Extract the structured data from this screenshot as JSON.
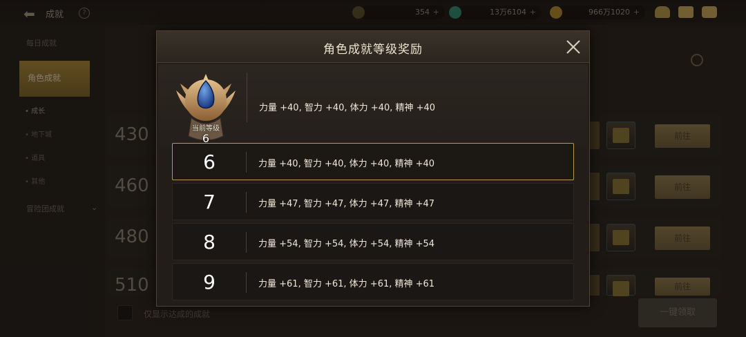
{
  "topbar": {
    "title": "成就",
    "help_icon": "question-icon",
    "currencies": [
      {
        "name": "coin-c-icon",
        "value": "354",
        "color": "#7d6b3a"
      },
      {
        "name": "gem-icon",
        "value": "13万6104",
        "color": "#2f8c74"
      },
      {
        "name": "gold-icon",
        "value": "966万1020",
        "color": "#b48a2e"
      }
    ],
    "icons": [
      "treasure-icon",
      "mail-icon",
      "chat-icon"
    ]
  },
  "sidebar": {
    "items": [
      {
        "label": "每日成就"
      },
      {
        "label": "角色成就",
        "active": true
      },
      {
        "label": "冒险团成就"
      }
    ],
    "sub_items": [
      {
        "label": "• 成长",
        "selected": true
      },
      {
        "label": "• 地下城"
      },
      {
        "label": "• 道具"
      },
      {
        "label": "• 其他"
      }
    ]
  },
  "background_rows": [
    {
      "score": "430",
      "button": "前往"
    },
    {
      "score": "460",
      "button": "前往"
    },
    {
      "score": "480",
      "button": "前往"
    },
    {
      "score": "510",
      "button": "前往"
    }
  ],
  "footer": {
    "only_show_label": "仅显示达成的成就",
    "claim_all_label": "一键领取"
  },
  "modal": {
    "title": "角色成就等级奖励",
    "current": {
      "label": "当前等级",
      "level": "6",
      "stats": "力量 +40, 智力 +40, 体力 +40, 精神 +40"
    },
    "levels": [
      {
        "level": "6",
        "stats": "力量 +40, 智力 +40, 体力 +40, 精神 +40",
        "selected": true
      },
      {
        "level": "7",
        "stats": "力量 +47, 智力 +47, 体力 +47, 精神 +47"
      },
      {
        "level": "8",
        "stats": "力量 +54, 智力 +54, 体力 +54, 精神 +54"
      },
      {
        "level": "9",
        "stats": "力量 +61, 智力 +61, 体力 +61, 精神 +61"
      }
    ]
  }
}
